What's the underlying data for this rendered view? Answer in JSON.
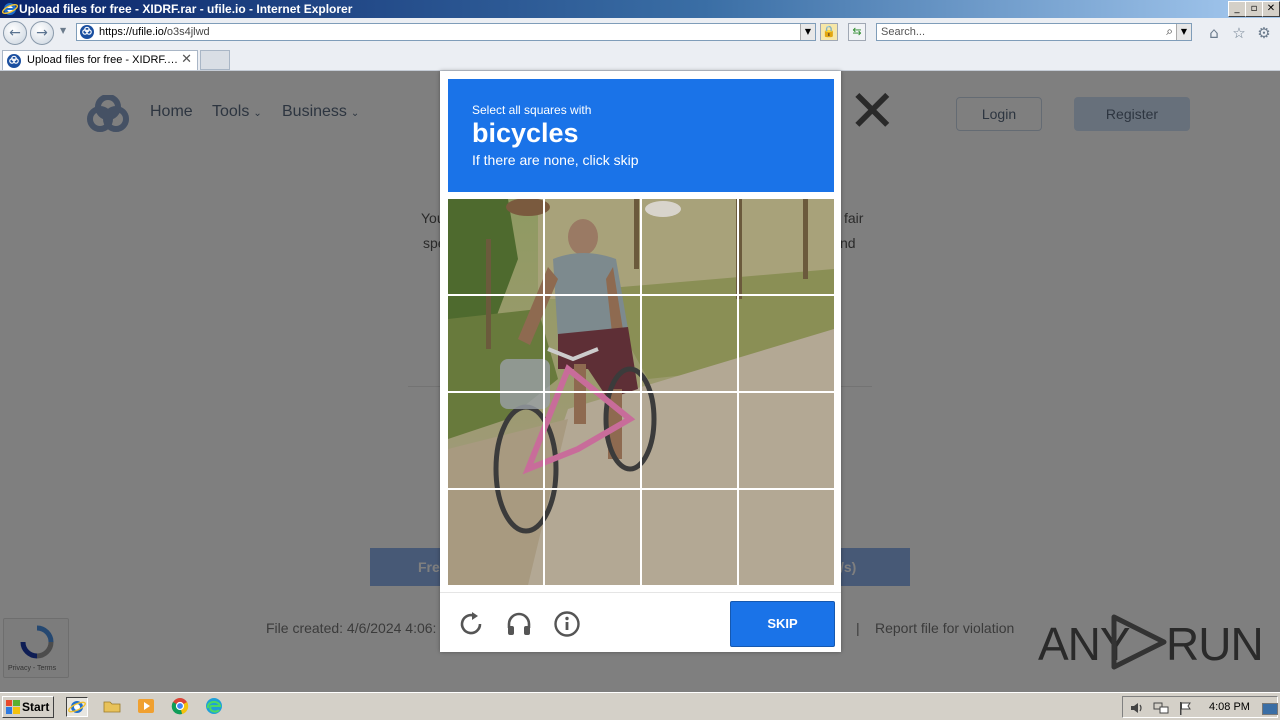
{
  "window": {
    "title": "Upload files for free - XIDRF.rar - ufile.io - Internet Explorer",
    "minimize": "_",
    "maximize": "▫",
    "close": "✕"
  },
  "address_bar": {
    "url_host": "https://ufile.io/",
    "url_path": "o3s4jlwd",
    "search_placeholder": "Search..."
  },
  "tabs": [
    {
      "label": "Upload files for free - XIDRF.…",
      "close": "✕"
    }
  ],
  "site": {
    "nav": [
      {
        "label": "Home"
      },
      {
        "label": "Tools"
      },
      {
        "label": "Business"
      }
    ],
    "caret": "⌄",
    "login": "Login",
    "register": "Register",
    "modal_text_left_1": "You",
    "modal_text_right_1": "fair",
    "modal_text_left_2": "spe",
    "modal_text_right_2": "nd",
    "modal_close": "✕",
    "download_left": "Fre",
    "download_right": "/s)",
    "file_created": "File created: 4/6/2024 4:06:",
    "separator": "|",
    "report": "Report file for violation",
    "recaptcha_badge_text": "Privacy - Terms",
    "watermark": {
      "left": "ANY",
      "right": "RUN"
    }
  },
  "captcha": {
    "instruction_line1": "Select all squares with",
    "target": "bicycles",
    "instruction_line3": "If there are none, click skip",
    "skip_label": "SKIP",
    "grid_rows": 4,
    "grid_cols": 4
  },
  "taskbar": {
    "start_label": "Start",
    "clock": "4:08 PM"
  }
}
